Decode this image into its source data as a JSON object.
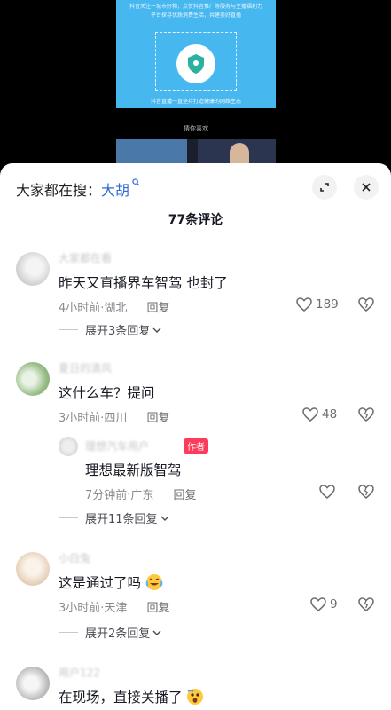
{
  "video": {
    "top_caption": "抖音关注一城市好物，点赞抖音推广等服务与主播福利力",
    "sub_caption": "平台探寻优质消费生活，共建美好直播",
    "bottom_caption": "抖音直播一直坚持打造健康的网络生态",
    "tag_text": "猜你喜欢"
  },
  "header": {
    "search_prefix": "大家都在搜：",
    "search_keyword": "大胡",
    "comment_count": "77条评论"
  },
  "comments": [
    {
      "username": "大家都在看",
      "text": "昨天又直播界车智驾  也封了",
      "time": "4小时前",
      "location": "湖北",
      "reply_label": "回复",
      "likes": "189",
      "expand": "展开3条回复"
    },
    {
      "username": "夏日的清风",
      "text": "这什么车？提问",
      "time": "3小时前",
      "location": "四川",
      "reply_label": "回复",
      "likes": "48",
      "expand": "展开11条回复",
      "reply": {
        "username": "理想汽车用户",
        "badge": "作者",
        "text": "理想最新版智驾",
        "time": "7分钟前",
        "location": "广东",
        "reply_label": "回复"
      }
    },
    {
      "username": "小白兔",
      "text": "这是通过了吗",
      "time": "3小时前",
      "location": "天津",
      "reply_label": "回复",
      "likes": "9",
      "expand": "展开2条回复"
    },
    {
      "username": "用户122",
      "text": "在现场，直接关播了"
    }
  ],
  "colors": {
    "accent_blue": "#2f6bd1",
    "author_badge": "#ff3b5c"
  }
}
